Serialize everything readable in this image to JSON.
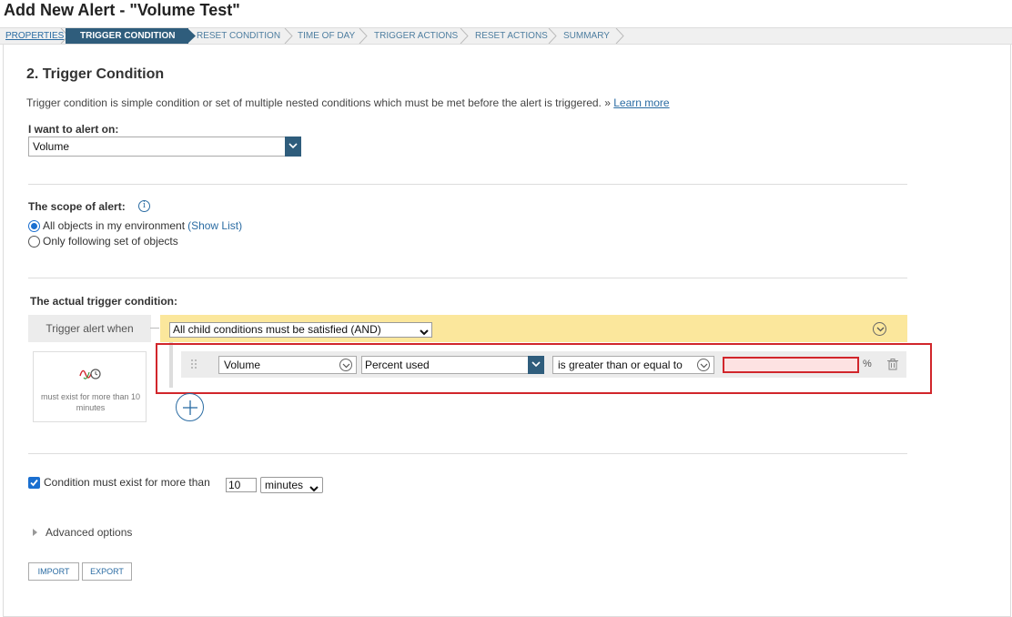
{
  "page_title": "Add New Alert - \"Volume Test\"",
  "wizard": {
    "steps": [
      "PROPERTIES",
      "TRIGGER CONDITION",
      "RESET CONDITION",
      "TIME OF DAY",
      "TRIGGER ACTIONS",
      "RESET ACTIONS",
      "SUMMARY"
    ],
    "active_step": "TRIGGER CONDITION"
  },
  "section": {
    "heading": "2. Trigger Condition",
    "description": "Trigger condition is simple condition or set of multiple nested conditions which must be met before the alert is triggered. »",
    "learn_more": "Learn more"
  },
  "alert_on": {
    "label": "I want to alert on:",
    "value": "Volume"
  },
  "scope": {
    "label": "The scope of alert:",
    "options": [
      {
        "label": "All objects in my environment",
        "link": "(Show List)",
        "checked": true
      },
      {
        "label": "Only following set of objects",
        "checked": false
      }
    ]
  },
  "trigger": {
    "label": "The actual trigger condition:",
    "when_label": "Trigger alert when",
    "group_condition": "All child conditions must be satisfied (AND)",
    "side_caption": "must exist for more than 10 minutes",
    "row": {
      "object": "Volume",
      "field": "Percent used",
      "operator": "is greater than or equal to",
      "value": "",
      "unit": "%"
    }
  },
  "condition_exist": {
    "checked": true,
    "label": "Condition must exist for more than",
    "value": "10",
    "unit": "minutes"
  },
  "advanced_label": "Advanced options",
  "buttons": {
    "import": "IMPORT",
    "export": "EXPORT"
  },
  "colors": {
    "accent": "#2f5d7c",
    "link": "#2b6ca3",
    "and_bar": "#fbe79c",
    "error": "#d1262b"
  }
}
